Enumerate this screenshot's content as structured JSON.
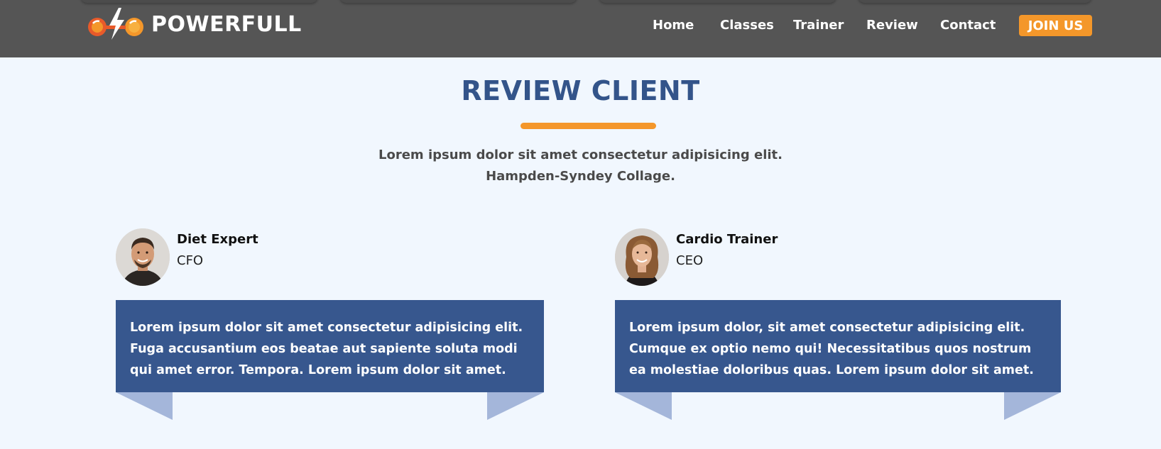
{
  "brand": {
    "name": "POWERFULL",
    "logo_icon": "dumbbell-lightning-icon"
  },
  "nav": {
    "items": [
      {
        "label": "Home"
      },
      {
        "label": "Classes"
      },
      {
        "label": "Trainer"
      },
      {
        "label": "Review"
      },
      {
        "label": "Contact"
      }
    ],
    "cta_label": "JOIN US"
  },
  "section": {
    "title": "REVIEW CLIENT",
    "subtitle_line1": "Lorem ipsum dolor sit amet consectetur adipisicing elit.",
    "subtitle_line2": "Hampden-Syndey Collage."
  },
  "reviews": [
    {
      "name": "Diet Expert",
      "role": "CFO",
      "text": "Lorem ipsum dolor sit amet consectetur adipisicing elit. Fuga accusantium eos beatae aut sapiente soluta modi qui amet error. Tempora. Lorem ipsum dolor sit amet."
    },
    {
      "name": "Cardio Trainer",
      "role": "CEO",
      "text": "Lorem ipsum dolor, sit amet consectetur adipisicing elit. Cumque ex optio nemo qui! Necessitatibus quos nostrum ea molestiae doloribus quas. Lorem ipsum dolor sit amet."
    }
  ],
  "colors": {
    "header_bg": "#555555",
    "accent_orange": "#f4972a",
    "title_blue": "#33548a",
    "card_blue": "#37578e",
    "ribbon_blue": "#a4b6da",
    "page_bg": "#f1f7fe"
  }
}
